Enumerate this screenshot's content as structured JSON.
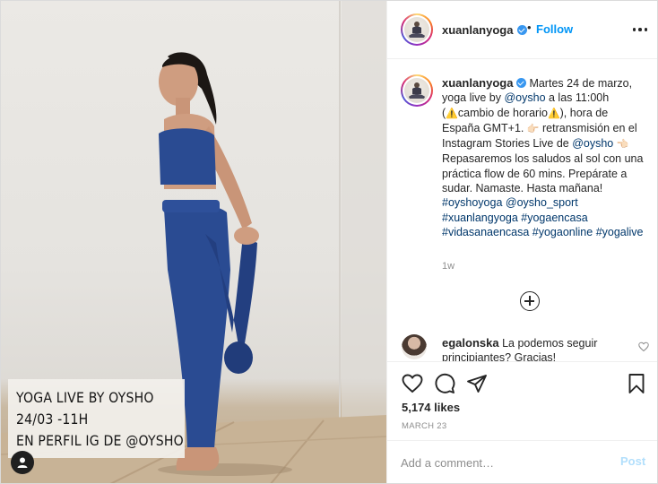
{
  "post": {
    "image": {
      "overlay_lines": [
        "YOGA LIVE BY OYSHO",
        "24/03 -11H",
        "EN PERFIL IG DE @OYSHO"
      ],
      "user_tag_icon": "user-tag-icon"
    },
    "header": {
      "username": "xuanlanyoga",
      "verified": true,
      "separator": "•",
      "follow_label": "Follow",
      "more_icon": "more-options-icon"
    },
    "caption": {
      "username": "xuanlanyoga",
      "segments": {
        "s1": "Martes 24 de marzo, yoga live by ",
        "m1": "@oysho",
        "s2": " a las 11:00h (",
        "e1": "⚠️",
        "s3": "cambio de horario",
        "e2": "⚠️",
        "s4": "), hora de España GMT+1. ",
        "e3": "👉🏻",
        "s5": " retransmisión en el Instagram Stories Live de ",
        "m2": "@oysho",
        "s6": " ",
        "e4": "👈🏻",
        "s7": " Repasaremos los saludos al sol con una práctica flow de 60 mins. Prepárate a sudar. Namaste. Hasta mañana! ",
        "h1": "#oyshoyoga",
        "s8": " ",
        "m3": "@oysho_sport",
        "s9": " ",
        "h2": "#xuanlangyoga",
        "s10": " ",
        "h3": "#yogaencasa",
        "s11": " ",
        "h4": "#vidasanaencasa",
        "s12": " ",
        "h5": "#yogaonline",
        "s13": " ",
        "h6": "#yogalive"
      },
      "age": "1w"
    },
    "load_more_icon": "plus-circle-icon",
    "comments": [
      {
        "username": "egalonska",
        "text": "La podemos seguir principiantes? Gracias!"
      }
    ],
    "actions": {
      "likes": "5,174 likes",
      "date": "MARCH 23"
    },
    "comment_box": {
      "placeholder": "Add a comment…",
      "post_label": "Post"
    },
    "colors": {
      "link": "#00376b",
      "follow": "#0095f6",
      "post_disabled": "#b2dffc",
      "secondary_text": "#8e8e8e",
      "border": "#dbdbdb"
    }
  }
}
